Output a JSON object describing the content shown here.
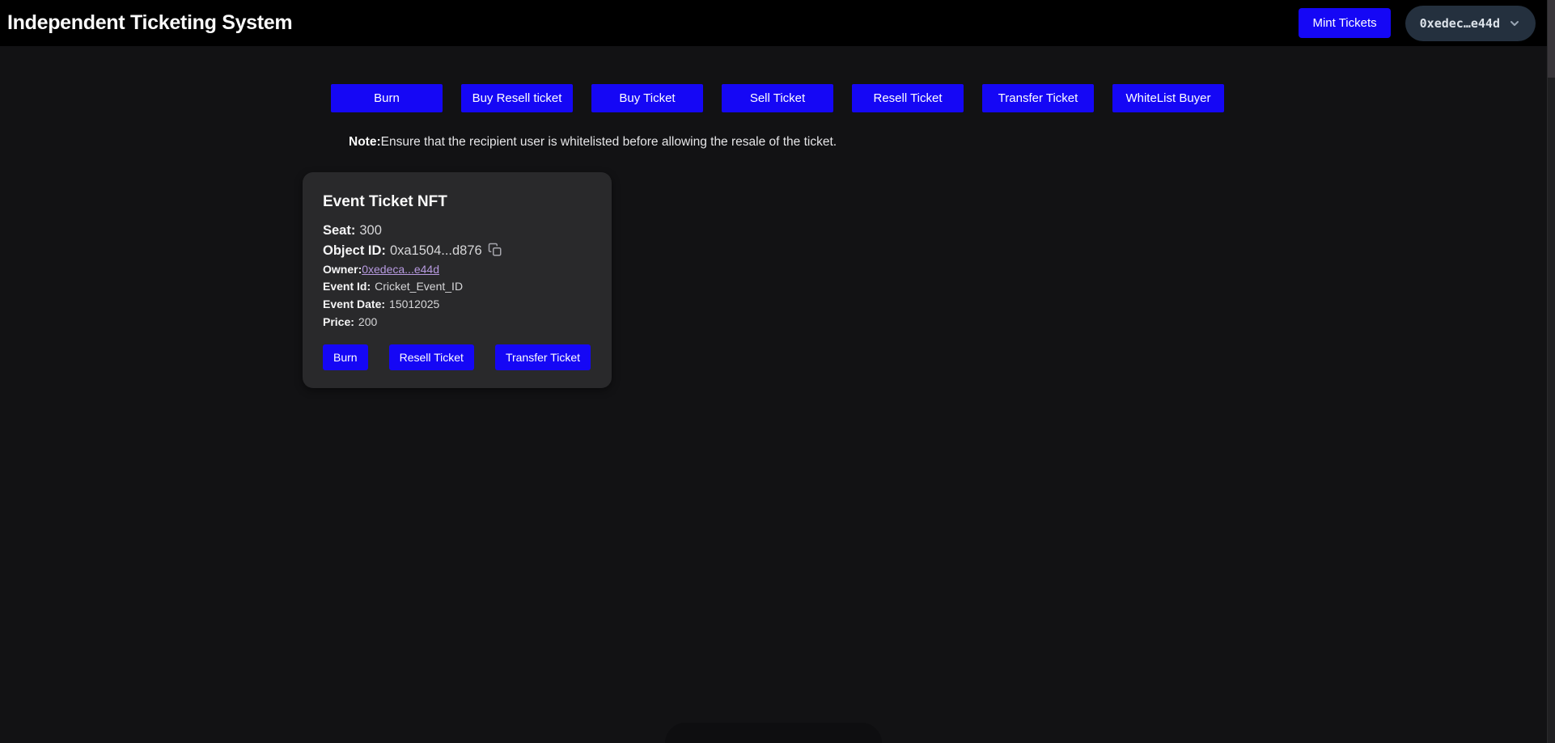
{
  "header": {
    "title": "Independent Ticketing System",
    "mint_button": "Mint Tickets",
    "wallet": {
      "address": "0xedec…e44d",
      "chevron_icon": "chevron-down"
    }
  },
  "nav": {
    "buttons": [
      "Burn",
      "Buy Resell ticket",
      "Buy Ticket",
      "Sell Ticket",
      "Resell Ticket",
      "Transfer Ticket",
      "WhiteList Buyer"
    ]
  },
  "note": {
    "label": "Note:",
    "text": "Ensure that the recipient user is whitelisted before allowing the resale of the ticket."
  },
  "ticket_card": {
    "title": "Event Ticket NFT",
    "seat": {
      "label": "Seat:",
      "value": "300"
    },
    "object_id": {
      "label": "Object ID:",
      "value": "0xa1504...d876",
      "copy_icon": "copy-icon"
    },
    "owner": {
      "label": "Owner:",
      "value": "0xedeca...e44d"
    },
    "event_id": {
      "label": "Event Id:",
      "value": "Cricket_Event_ID"
    },
    "event_date": {
      "label": "Event Date:",
      "value": "15012025"
    },
    "price": {
      "label": "Price:",
      "value": "200"
    },
    "actions": [
      "Burn",
      "Resell Ticket",
      "Transfer Ticket"
    ]
  },
  "colors": {
    "accent_blue": "#1507f5",
    "link_purple": "#b79ae0",
    "header_bg": "#000000",
    "page_bg": "#121214",
    "card_bg": "#29292b",
    "wallet_pill_bg": "#24303e"
  }
}
